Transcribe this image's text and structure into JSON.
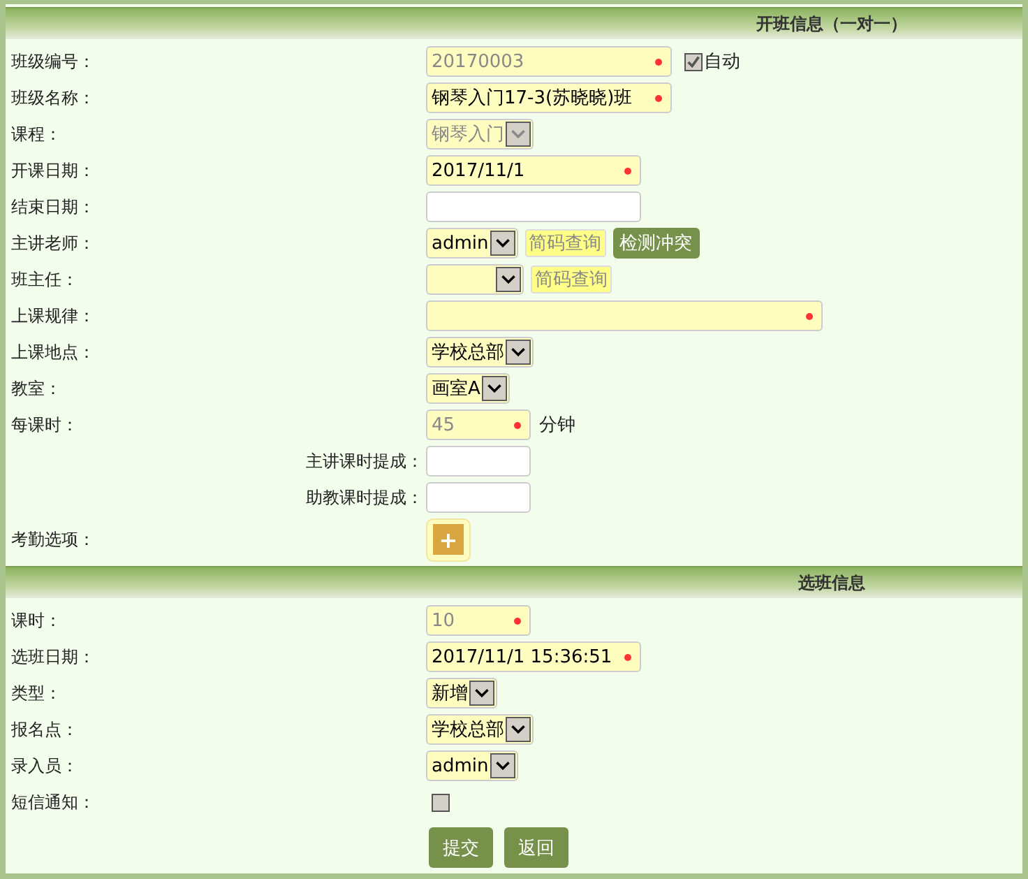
{
  "sections": [
    {
      "title": "开班信息（一对一）",
      "rows": [
        {
          "label": "班级编号：",
          "kind": "main",
          "control": {
            "kind": "input",
            "value": "20170003",
            "required": true,
            "disabled": true
          },
          "extras": [
            {
              "kind": "checkbox",
              "label": "自动",
              "checked": true
            }
          ]
        },
        {
          "label": "班级名称：",
          "kind": "main",
          "control": {
            "kind": "input",
            "value": "钢琴入门17-3(苏晓晓)班",
            "required": true,
            "disabled": false
          }
        },
        {
          "label": "课程：",
          "kind": "main",
          "control": {
            "kind": "select",
            "value": "钢琴入门",
            "disabled": true
          }
        },
        {
          "label": "开课日期：",
          "kind": "main",
          "control": {
            "kind": "input",
            "value": "2017/11/1",
            "required": true,
            "disabled": false
          }
        },
        {
          "label": "结束日期：",
          "kind": "main",
          "control": {
            "kind": "input",
            "required": false
          }
        },
        {
          "label": "主讲老师：",
          "kind": "main",
          "control": {
            "kind": "select",
            "value": "admin",
            "disabled": false
          },
          "extras": [
            {
              "kind": "lookup",
              "label": "简码查询"
            },
            {
              "kind": "action",
              "label": "检测冲突"
            }
          ]
        },
        {
          "label": "班主任：",
          "kind": "main",
          "control": {
            "kind": "select",
            "disabled": false
          },
          "extras": [
            {
              "kind": "lookup",
              "label": "简码查询"
            }
          ]
        },
        {
          "label": "上课规律：",
          "kind": "main",
          "control": {
            "kind": "input",
            "required": true
          }
        },
        {
          "label": "上课地点：",
          "kind": "main",
          "control": {
            "kind": "select",
            "value": "学校总部",
            "disabled": false
          }
        },
        {
          "label": "教室：",
          "kind": "main",
          "control": {
            "kind": "select",
            "value": "画室A",
            "disabled": false
          }
        },
        {
          "label": "每课时：",
          "kind": "main",
          "control": {
            "kind": "input",
            "value": "45",
            "required": true,
            "disabled": true
          },
          "extras": [
            {
              "kind": "unit",
              "label": "分钟"
            }
          ]
        },
        {
          "label": "主讲课时提成：",
          "kind": "sub",
          "control": {
            "kind": "input",
            "required": false
          }
        },
        {
          "label": "助教课时提成：",
          "kind": "sub",
          "control": {
            "kind": "input",
            "required": false
          }
        },
        {
          "label": "考勤选项：",
          "kind": "main",
          "control": {
            "kind": "add",
            "label": "+"
          }
        }
      ]
    },
    {
      "title": "选班信息",
      "rows": [
        {
          "label": "课时：",
          "kind": "main",
          "control": {
            "kind": "input",
            "value": "10",
            "required": true,
            "disabled": true
          }
        },
        {
          "label": "选班日期：",
          "kind": "main",
          "control": {
            "kind": "input",
            "value": "2017/11/1 15:36:51",
            "required": true,
            "disabled": false
          }
        },
        {
          "label": "类型：",
          "kind": "main",
          "control": {
            "kind": "select",
            "value": "新增",
            "disabled": false
          }
        },
        {
          "label": "报名点：",
          "kind": "main",
          "control": {
            "kind": "select",
            "value": "学校总部",
            "disabled": false
          }
        },
        {
          "label": "录入员：",
          "kind": "main",
          "control": {
            "kind": "select",
            "value": "admin",
            "disabled": false
          }
        },
        {
          "label": "短信通知：",
          "kind": "main",
          "control": {
            "kind": "checkbox",
            "checked": false
          }
        }
      ]
    }
  ],
  "buttons": [
    "提交",
    "返回"
  ]
}
